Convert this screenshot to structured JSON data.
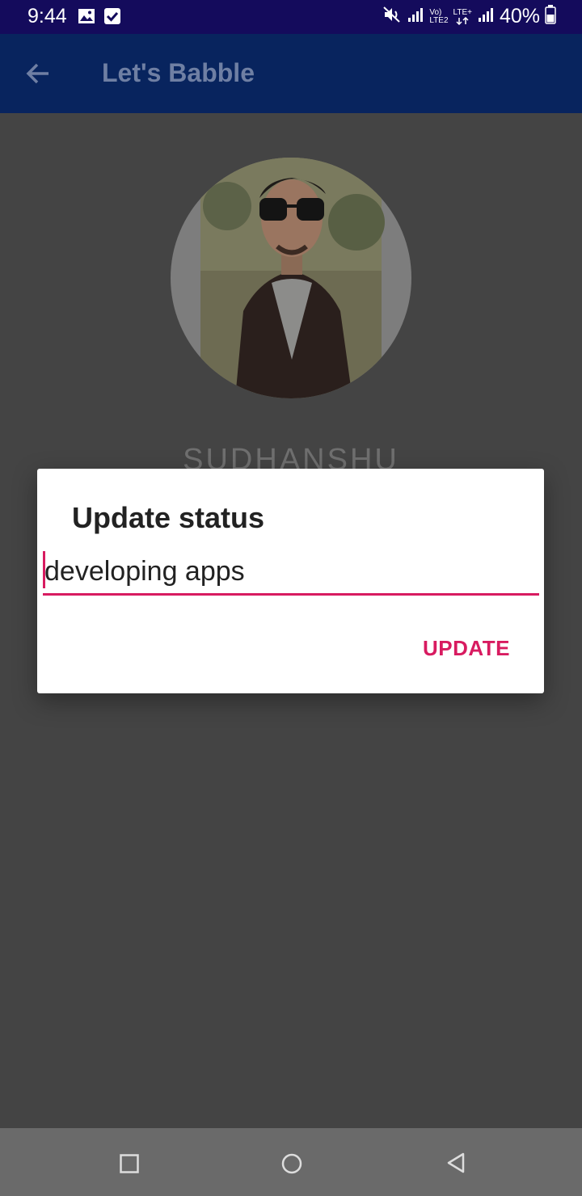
{
  "status_bar": {
    "time": "9:44",
    "battery": "40%",
    "network_labels": [
      "Vo)",
      "LTE+",
      "LTE2"
    ]
  },
  "app_bar": {
    "title": "Let's Babble",
    "back_icon": "arrow-left-icon"
  },
  "profile": {
    "name": "SUDHANSHU"
  },
  "dialog": {
    "title": "Update status",
    "input_value": "developing apps",
    "update_label": "UPDATE"
  },
  "nav_bar": {
    "icons": [
      "recent-apps-icon",
      "home-icon",
      "back-icon"
    ]
  },
  "colors": {
    "accent": "#d81b60",
    "status_bar": "#140b5c",
    "app_bar": "#08245e",
    "scrim_background": "#444444"
  }
}
